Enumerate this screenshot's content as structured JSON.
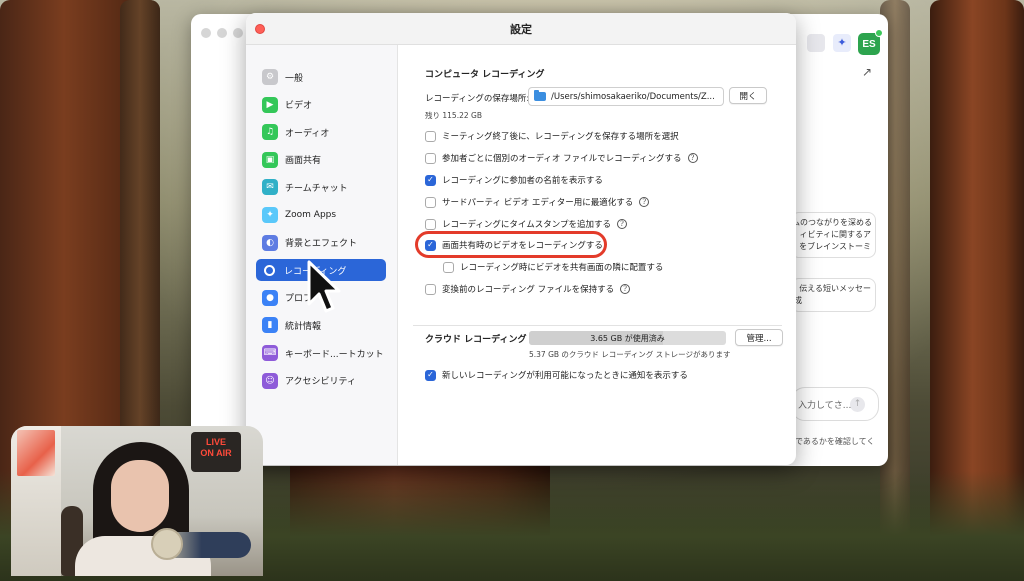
{
  "settings_window": {
    "title": "設定",
    "sidebar": [
      {
        "label": "一般",
        "icon": "gear-icon",
        "color": "#c8c8cc"
      },
      {
        "label": "ビデオ",
        "icon": "video-camera-icon",
        "color": "#34c759"
      },
      {
        "label": "オーディオ",
        "icon": "headphones-icon",
        "color": "#34c759"
      },
      {
        "label": "画面共有",
        "icon": "screen-share-icon",
        "color": "#34c759"
      },
      {
        "label": "チームチャット",
        "icon": "chat-icon",
        "color": "#30b0c7"
      },
      {
        "label": "Zoom Apps",
        "icon": "apps-icon",
        "color": "#5ac8fa"
      },
      {
        "label": "背景とエフェクト",
        "icon": "background-icon",
        "color": "#5e7ce2"
      },
      {
        "label": "レコーディング",
        "icon": "record-icon",
        "color": "#2b66d8",
        "active": true
      },
      {
        "label": "プロフ",
        "icon": "profile-icon",
        "color": "#3b82f6"
      },
      {
        "label": "統計情報",
        "icon": "statistics-icon",
        "color": "#3b82f6"
      },
      {
        "label": "キーボード...ートカット",
        "icon": "keyboard-icon",
        "color": "#8e5bd9"
      },
      {
        "label": "アクセシビリティ",
        "icon": "accessibility-icon",
        "color": "#8e5bd9"
      }
    ],
    "local_recording": {
      "heading": "コンピュータ レコーディング",
      "save_location_label": "レコーディングの保存場所:",
      "save_path": "/Users/shimosakaeriko/Documents/Z...",
      "open_button": "開く",
      "remaining": "残り 115.22 GB",
      "options": [
        {
          "label": "ミーティング終了後に、レコーディングを保存する場所を選択",
          "checked": false,
          "info": false
        },
        {
          "label": "参加者ごとに個別のオーディオ ファイルでレコーディングする",
          "checked": false,
          "info": true
        },
        {
          "label": "レコーディングに参加者の名前を表示する",
          "checked": true,
          "info": false
        },
        {
          "label": "サードパーティ ビデオ エディター用に最適化する",
          "checked": false,
          "info": true
        },
        {
          "label": "レコーディングにタイムスタンプを追加する",
          "checked": false,
          "info": true
        },
        {
          "label": "画面共有時のビデオをレコーディングする",
          "checked": true,
          "info": false
        },
        {
          "label": "レコーディング時にビデオを共有画面の隣に配置する",
          "checked": false,
          "info": false
        },
        {
          "label": "変換前のレコーディング ファイルを保持する",
          "checked": false,
          "info": true
        }
      ]
    },
    "cloud_recording": {
      "heading": "クラウド レコーディング",
      "usage": "3.65 GB が使用済み",
      "usage_fraction": 0.68,
      "manage_button": "管理...",
      "storage_note": "5.37 GB のクラウド レコーディング ストレージがあります",
      "notify_label": "新しいレコーディングが利用可能になったときに通知を表示する",
      "notify_checked": true
    },
    "info_glyph": "?",
    "check_glyph": "✓"
  },
  "main_window": {
    "avatar_initials": "ES",
    "ai_panel": {
      "card1_lines": [
        "ムのつながりを深める",
        "ィビティに関するア",
        "をブレインストーミ"
      ],
      "card2_lines": [
        "伝える短いメッセー",
        "成"
      ],
      "input_placeholder": "入力してさ...",
      "footer": "確であるかを確認してく"
    }
  },
  "webcam": {
    "sign_text": "LIVE\nON AIR"
  },
  "colors": {
    "accent": "#2b66d8",
    "highlight_ring": "#e33b2a",
    "close_button": "#ff5f57"
  }
}
